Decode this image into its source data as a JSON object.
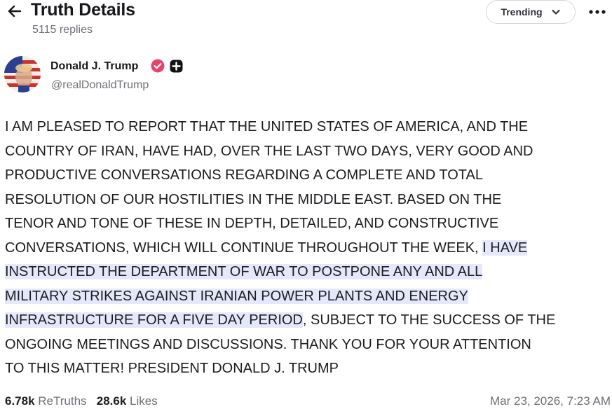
{
  "header": {
    "title": "Truth Details",
    "subtitle": "5115 replies",
    "trending_label": "Trending",
    "icons": {
      "back": "arrow-left-icon",
      "dropdown": "chevron-down-icon",
      "more": "more-horizontal-icon"
    }
  },
  "author": {
    "name": "Donald J. Trump",
    "handle": "@realDonaldTrump",
    "icons": {
      "verified": "verified-badge-icon",
      "badge": "plus-badge-icon"
    },
    "colors": {
      "verified": "#e8416a",
      "badge": "#111111"
    }
  },
  "post": {
    "lines": [
      [
        {
          "text": "I AM PLEASED TO REPORT THAT THE UNITED STATES OF AMERICA, AND THE"
        }
      ],
      [
        {
          "text": "COUNTRY OF IRAN, HAVE HAD, OVER THE LAST TWO DAYS, VERY GOOD AND"
        }
      ],
      [
        {
          "text": "PRODUCTIVE CONVERSATIONS REGARDING A COMPLETE AND TOTAL"
        }
      ],
      [
        {
          "text": "RESOLUTION OF OUR HOSTILITIES IN THE MIDDLE EAST. BASED ON THE"
        }
      ],
      [
        {
          "text": "TENOR AND TONE OF THESE IN DEPTH, DETAILED, AND CONSTRUCTIVE"
        }
      ],
      [
        {
          "text": "CONVERSATIONS, WHICH WILL CONTINUE THROUGHOUT THE WEEK, "
        },
        {
          "text": "I HAVE",
          "highlight": true
        }
      ],
      [
        {
          "text": "INSTRUCTED THE DEPARTMENT OF WAR TO POSTPONE ANY AND ALL",
          "highlight": true
        }
      ],
      [
        {
          "text": "MILITARY STRIKES AGAINST IRANIAN POWER PLANTS AND ENERGY",
          "highlight": true
        }
      ],
      [
        {
          "text": "INFRASTRUCTURE FOR A FIVE DAY PERIOD",
          "highlight": true
        },
        {
          "text": ", SUBJECT TO THE SUCCESS OF THE"
        }
      ],
      [
        {
          "text": "ONGOING MEETINGS AND DISCUSSIONS. THANK YOU FOR YOUR ATTENTION"
        }
      ],
      [
        {
          "text": "TO THIS MATTER! PRESIDENT DONALD J. TRUMP"
        }
      ]
    ],
    "highlight_color": "#e5e7fa"
  },
  "stats": {
    "retruths_count": "6.78k",
    "retruths_label": "ReTruths",
    "likes_count": "28.6k",
    "likes_label": "Likes",
    "date": "Mar 23, 2026, 7:23 AM"
  }
}
